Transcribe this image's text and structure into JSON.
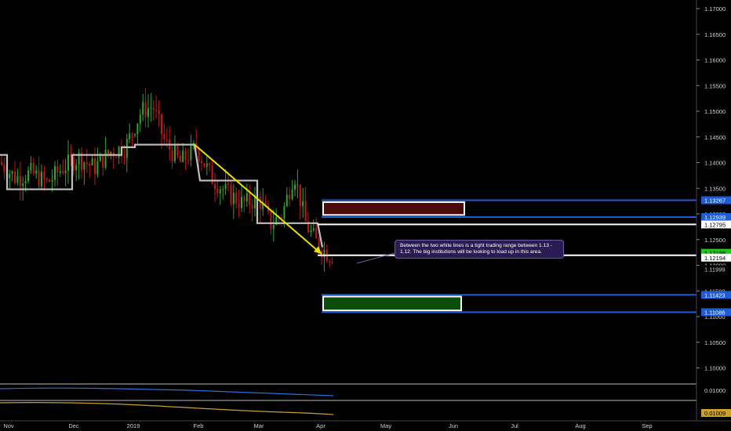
{
  "chart_data": {
    "type": "candlestick",
    "instrument_hint": "daily price chart",
    "y_axis": {
      "position": "right",
      "ticks": [
        "1.17000",
        "1.16500",
        "1.16000",
        "1.15500",
        "1.15000",
        "1.14500",
        "1.14000",
        "1.13500",
        "1.13000",
        "1.12500",
        "1.12000",
        "1.11500",
        "1.11000",
        "1.10500",
        "1.10000"
      ]
    },
    "x_axis": {
      "ticks": [
        "Nov",
        "Dec",
        "2019",
        "Feb",
        "Mar",
        "Apr",
        "May",
        "Jun",
        "Jul",
        "Aug",
        "Sep"
      ]
    },
    "price_labels": [
      {
        "value": "1.13267",
        "style": "blue"
      },
      {
        "value": "1.12939",
        "style": "blue"
      },
      {
        "value": "1.12795",
        "style": "white"
      },
      {
        "value": "1.12198",
        "style": "green"
      },
      {
        "value": "1.12194",
        "style": "white"
      },
      {
        "value": "1.11999",
        "style": "plain"
      },
      {
        "value": "1.11423",
        "style": "blue"
      },
      {
        "value": "1.11086",
        "style": "blue"
      }
    ],
    "horizontal_lines": [
      {
        "price": 1.13267,
        "color": "#1e5bd6"
      },
      {
        "price": 1.12939,
        "color": "#1e5bd6"
      },
      {
        "price": 1.12795,
        "color": "#ffffff"
      },
      {
        "price": 1.12194,
        "color": "#ffffff"
      },
      {
        "price": 1.11423,
        "color": "#1e5bd6"
      },
      {
        "price": 1.11086,
        "color": "#1e5bd6"
      }
    ],
    "zones": [
      {
        "name": "supply-zone",
        "top": 1.1323,
        "bottom": 1.1298,
        "fill": "#4d0a0a"
      },
      {
        "name": "demand-zone",
        "top": 1.1139,
        "bottom": 1.1112,
        "fill": "#0b4d0b"
      }
    ],
    "trend_arrow": {
      "from": {
        "date": "Feb",
        "price": 1.1435
      },
      "to": {
        "date": "Apr",
        "price": 1.1222
      },
      "color": "#e8e000"
    },
    "step_line_levels": [
      1.1415,
      1.1348,
      1.1415,
      1.1435,
      1.1365,
      1.1378,
      1.1282
    ],
    "indicator_panels": [
      {
        "label": "0.01000",
        "color": "#2e6fd6"
      },
      {
        "label": "0.01009",
        "color": "#c9a227"
      }
    ],
    "colors": {
      "up": "#2fa52f",
      "down": "#c0191c",
      "step_line": "#bfbfbf",
      "background": "#000000"
    }
  },
  "annotation": {
    "text": "Between the two white lines is a tight trading range between 1.13 - 1.12. The big institutions will be looking to load up in this area."
  }
}
